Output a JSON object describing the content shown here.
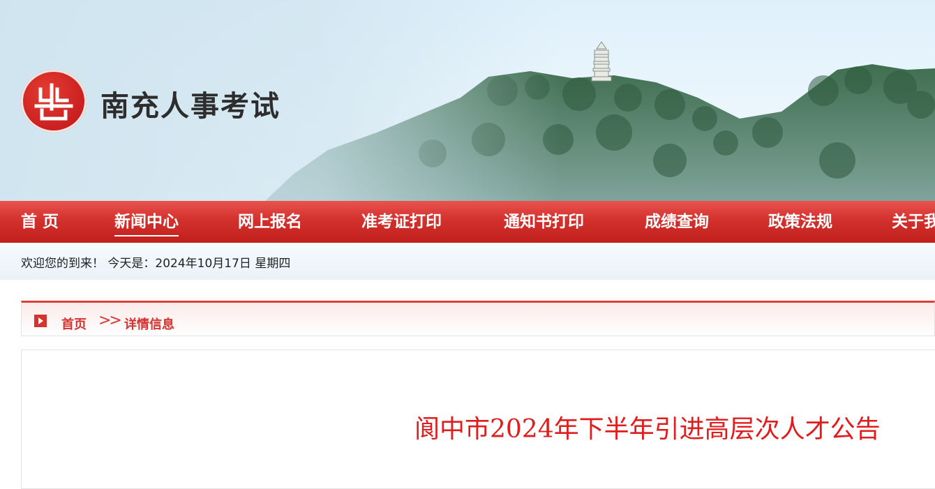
{
  "header": {
    "site_title": "南充人事考试"
  },
  "nav": {
    "items": [
      {
        "label": "首 页",
        "active": false
      },
      {
        "label": "新闻中心",
        "active": true
      },
      {
        "label": "网上报名",
        "active": false
      },
      {
        "label": "准考证打印",
        "active": false
      },
      {
        "label": "通知书打印",
        "active": false
      },
      {
        "label": "成绩查询",
        "active": false
      },
      {
        "label": "政策法规",
        "active": false
      },
      {
        "label": "关于我们",
        "active": false
      }
    ]
  },
  "welcome": {
    "text": "欢迎您的到来！ 今天是：2024年10月17日 星期四"
  },
  "breadcrumb": {
    "home": "首页",
    "separator": ">>",
    "current": "详情信息"
  },
  "article": {
    "title": "阆中市2024年下半年引进高层次人才公告"
  },
  "colors": {
    "accent_red": "#d4332f",
    "title_red": "#e11c1c",
    "nav_gradient_top": "#e9534f",
    "nav_gradient_bottom": "#c0201d"
  }
}
